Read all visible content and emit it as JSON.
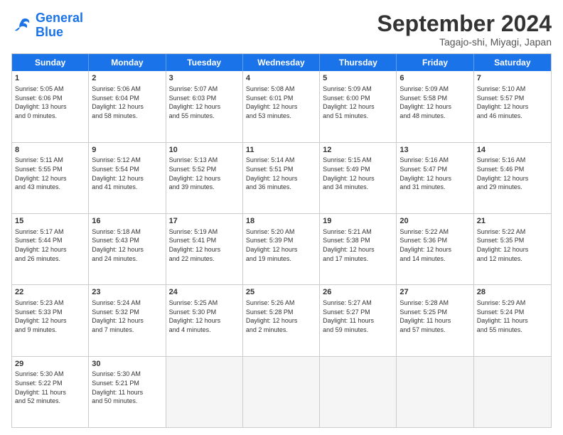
{
  "logo": {
    "line1": "General",
    "line2": "Blue"
  },
  "title": "September 2024",
  "location": "Tagajo-shi, Miyagi, Japan",
  "days_of_week": [
    "Sunday",
    "Monday",
    "Tuesday",
    "Wednesday",
    "Thursday",
    "Friday",
    "Saturday"
  ],
  "weeks": [
    [
      {
        "day": "1",
        "lines": [
          "Sunrise: 5:05 AM",
          "Sunset: 6:06 PM",
          "Daylight: 13 hours",
          "and 0 minutes."
        ]
      },
      {
        "day": "2",
        "lines": [
          "Sunrise: 5:06 AM",
          "Sunset: 6:04 PM",
          "Daylight: 12 hours",
          "and 58 minutes."
        ]
      },
      {
        "day": "3",
        "lines": [
          "Sunrise: 5:07 AM",
          "Sunset: 6:03 PM",
          "Daylight: 12 hours",
          "and 55 minutes."
        ]
      },
      {
        "day": "4",
        "lines": [
          "Sunrise: 5:08 AM",
          "Sunset: 6:01 PM",
          "Daylight: 12 hours",
          "and 53 minutes."
        ]
      },
      {
        "day": "5",
        "lines": [
          "Sunrise: 5:09 AM",
          "Sunset: 6:00 PM",
          "Daylight: 12 hours",
          "and 51 minutes."
        ]
      },
      {
        "day": "6",
        "lines": [
          "Sunrise: 5:09 AM",
          "Sunset: 5:58 PM",
          "Daylight: 12 hours",
          "and 48 minutes."
        ]
      },
      {
        "day": "7",
        "lines": [
          "Sunrise: 5:10 AM",
          "Sunset: 5:57 PM",
          "Daylight: 12 hours",
          "and 46 minutes."
        ]
      }
    ],
    [
      {
        "day": "8",
        "lines": [
          "Sunrise: 5:11 AM",
          "Sunset: 5:55 PM",
          "Daylight: 12 hours",
          "and 43 minutes."
        ]
      },
      {
        "day": "9",
        "lines": [
          "Sunrise: 5:12 AM",
          "Sunset: 5:54 PM",
          "Daylight: 12 hours",
          "and 41 minutes."
        ]
      },
      {
        "day": "10",
        "lines": [
          "Sunrise: 5:13 AM",
          "Sunset: 5:52 PM",
          "Daylight: 12 hours",
          "and 39 minutes."
        ]
      },
      {
        "day": "11",
        "lines": [
          "Sunrise: 5:14 AM",
          "Sunset: 5:51 PM",
          "Daylight: 12 hours",
          "and 36 minutes."
        ]
      },
      {
        "day": "12",
        "lines": [
          "Sunrise: 5:15 AM",
          "Sunset: 5:49 PM",
          "Daylight: 12 hours",
          "and 34 minutes."
        ]
      },
      {
        "day": "13",
        "lines": [
          "Sunrise: 5:16 AM",
          "Sunset: 5:47 PM",
          "Daylight: 12 hours",
          "and 31 minutes."
        ]
      },
      {
        "day": "14",
        "lines": [
          "Sunrise: 5:16 AM",
          "Sunset: 5:46 PM",
          "Daylight: 12 hours",
          "and 29 minutes."
        ]
      }
    ],
    [
      {
        "day": "15",
        "lines": [
          "Sunrise: 5:17 AM",
          "Sunset: 5:44 PM",
          "Daylight: 12 hours",
          "and 26 minutes."
        ]
      },
      {
        "day": "16",
        "lines": [
          "Sunrise: 5:18 AM",
          "Sunset: 5:43 PM",
          "Daylight: 12 hours",
          "and 24 minutes."
        ]
      },
      {
        "day": "17",
        "lines": [
          "Sunrise: 5:19 AM",
          "Sunset: 5:41 PM",
          "Daylight: 12 hours",
          "and 22 minutes."
        ]
      },
      {
        "day": "18",
        "lines": [
          "Sunrise: 5:20 AM",
          "Sunset: 5:39 PM",
          "Daylight: 12 hours",
          "and 19 minutes."
        ]
      },
      {
        "day": "19",
        "lines": [
          "Sunrise: 5:21 AM",
          "Sunset: 5:38 PM",
          "Daylight: 12 hours",
          "and 17 minutes."
        ]
      },
      {
        "day": "20",
        "lines": [
          "Sunrise: 5:22 AM",
          "Sunset: 5:36 PM",
          "Daylight: 12 hours",
          "and 14 minutes."
        ]
      },
      {
        "day": "21",
        "lines": [
          "Sunrise: 5:22 AM",
          "Sunset: 5:35 PM",
          "Daylight: 12 hours",
          "and 12 minutes."
        ]
      }
    ],
    [
      {
        "day": "22",
        "lines": [
          "Sunrise: 5:23 AM",
          "Sunset: 5:33 PM",
          "Daylight: 12 hours",
          "and 9 minutes."
        ]
      },
      {
        "day": "23",
        "lines": [
          "Sunrise: 5:24 AM",
          "Sunset: 5:32 PM",
          "Daylight: 12 hours",
          "and 7 minutes."
        ]
      },
      {
        "day": "24",
        "lines": [
          "Sunrise: 5:25 AM",
          "Sunset: 5:30 PM",
          "Daylight: 12 hours",
          "and 4 minutes."
        ]
      },
      {
        "day": "25",
        "lines": [
          "Sunrise: 5:26 AM",
          "Sunset: 5:28 PM",
          "Daylight: 12 hours",
          "and 2 minutes."
        ]
      },
      {
        "day": "26",
        "lines": [
          "Sunrise: 5:27 AM",
          "Sunset: 5:27 PM",
          "Daylight: 11 hours",
          "and 59 minutes."
        ]
      },
      {
        "day": "27",
        "lines": [
          "Sunrise: 5:28 AM",
          "Sunset: 5:25 PM",
          "Daylight: 11 hours",
          "and 57 minutes."
        ]
      },
      {
        "day": "28",
        "lines": [
          "Sunrise: 5:29 AM",
          "Sunset: 5:24 PM",
          "Daylight: 11 hours",
          "and 55 minutes."
        ]
      }
    ],
    [
      {
        "day": "29",
        "lines": [
          "Sunrise: 5:30 AM",
          "Sunset: 5:22 PM",
          "Daylight: 11 hours",
          "and 52 minutes."
        ]
      },
      {
        "day": "30",
        "lines": [
          "Sunrise: 5:30 AM",
          "Sunset: 5:21 PM",
          "Daylight: 11 hours",
          "and 50 minutes."
        ]
      },
      {
        "day": "",
        "lines": []
      },
      {
        "day": "",
        "lines": []
      },
      {
        "day": "",
        "lines": []
      },
      {
        "day": "",
        "lines": []
      },
      {
        "day": "",
        "lines": []
      }
    ]
  ]
}
